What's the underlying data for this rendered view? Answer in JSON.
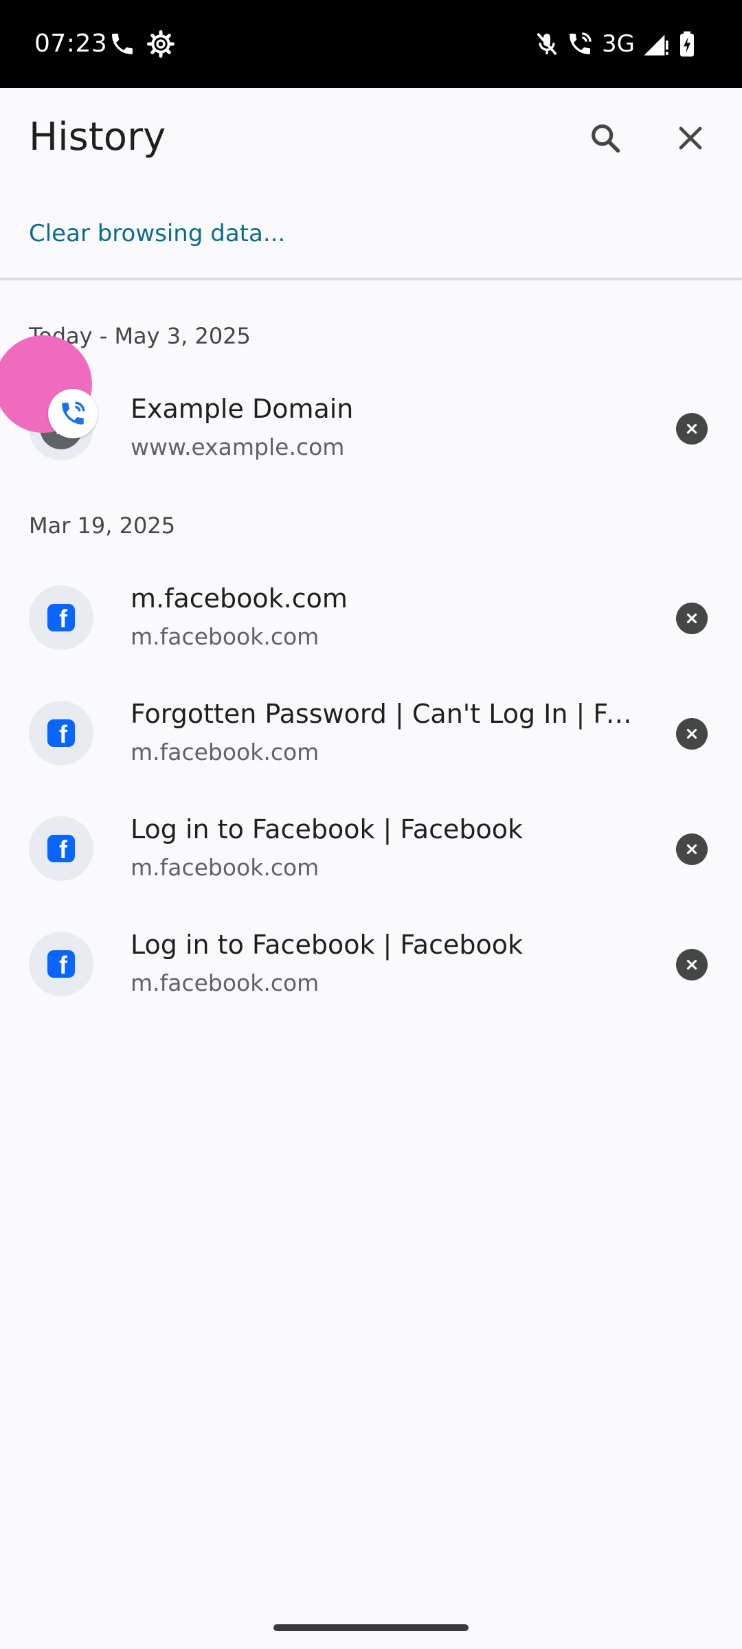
{
  "status_bar": {
    "time": "07:23",
    "network": "3G",
    "icons": [
      "phone-icon",
      "settings-gear-icon",
      "mic-off-icon",
      "wifi-calling-icon",
      "signal-icon",
      "battery-charging-icon"
    ]
  },
  "app_bar": {
    "title": "History",
    "search_icon": "search-icon",
    "close_icon": "close-icon"
  },
  "clear_browsing_label": "Clear browsing data...",
  "sections": [
    {
      "header": "Today - May 3, 2025",
      "items": [
        {
          "title": "Example Domain",
          "url": "www.example.com",
          "favicon": "E",
          "favicon_type": "letter"
        }
      ]
    },
    {
      "header": "Mar 19, 2025",
      "items": [
        {
          "title": "m.facebook.com",
          "url": "m.facebook.com",
          "favicon": "f",
          "favicon_type": "facebook"
        },
        {
          "title": "Forgotten Password | Can't Log In | Facebook",
          "url": "m.facebook.com",
          "favicon": "f",
          "favicon_type": "facebook"
        },
        {
          "title": "Log in to Facebook | Facebook",
          "url": "m.facebook.com",
          "favicon": "f",
          "favicon_type": "facebook"
        },
        {
          "title": "Log in to Facebook | Facebook",
          "url": "m.facebook.com",
          "favicon": "f",
          "favicon_type": "facebook"
        }
      ]
    }
  ],
  "colors": {
    "background": "#fafafd",
    "link": "#0b6b8d",
    "facebook_blue": "#0866ff",
    "remove_button": "#454746",
    "call_bubble": "#f06bbd"
  }
}
